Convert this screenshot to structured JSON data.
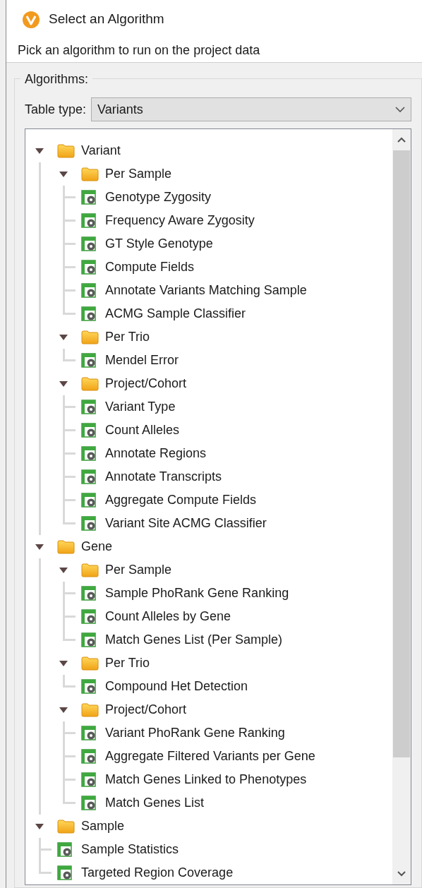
{
  "window": {
    "title": "Select an Algorithm"
  },
  "description": "Pick an algorithm to run on the project data",
  "group": {
    "label": "Algorithms:"
  },
  "table_type": {
    "label": "Table type:",
    "value": "Variants"
  },
  "tree": [
    {
      "kind": "folder",
      "label": "Variant",
      "expanded": true,
      "children": [
        {
          "kind": "folder",
          "label": "Per Sample",
          "expanded": true,
          "children": [
            {
              "kind": "algorithm",
              "label": "Genotype Zygosity"
            },
            {
              "kind": "algorithm",
              "label": "Frequency Aware Zygosity"
            },
            {
              "kind": "algorithm",
              "label": "GT Style Genotype"
            },
            {
              "kind": "algorithm",
              "label": "Compute Fields"
            },
            {
              "kind": "algorithm",
              "label": "Annotate Variants Matching Sample"
            },
            {
              "kind": "algorithm",
              "label": "ACMG Sample Classifier"
            }
          ]
        },
        {
          "kind": "folder",
          "label": "Per Trio",
          "expanded": true,
          "children": [
            {
              "kind": "algorithm",
              "label": "Mendel Error"
            }
          ]
        },
        {
          "kind": "folder",
          "label": "Project/Cohort",
          "expanded": true,
          "children": [
            {
              "kind": "algorithm",
              "label": "Variant Type"
            },
            {
              "kind": "algorithm",
              "label": "Count Alleles"
            },
            {
              "kind": "algorithm",
              "label": "Annotate Regions"
            },
            {
              "kind": "algorithm",
              "label": "Annotate Transcripts"
            },
            {
              "kind": "algorithm",
              "label": "Aggregate Compute Fields"
            },
            {
              "kind": "algorithm",
              "label": "Variant Site ACMG Classifier"
            }
          ]
        }
      ]
    },
    {
      "kind": "folder",
      "label": "Gene",
      "expanded": true,
      "children": [
        {
          "kind": "folder",
          "label": "Per Sample",
          "expanded": true,
          "children": [
            {
              "kind": "algorithm",
              "label": "Sample PhoRank Gene Ranking"
            },
            {
              "kind": "algorithm",
              "label": "Count Alleles by Gene"
            },
            {
              "kind": "algorithm",
              "label": "Match Genes List (Per Sample)"
            }
          ]
        },
        {
          "kind": "folder",
          "label": "Per Trio",
          "expanded": true,
          "children": [
            {
              "kind": "algorithm",
              "label": "Compound Het Detection"
            }
          ]
        },
        {
          "kind": "folder",
          "label": "Project/Cohort",
          "expanded": true,
          "children": [
            {
              "kind": "algorithm",
              "label": "Variant PhoRank Gene Ranking"
            },
            {
              "kind": "algorithm",
              "label": "Aggregate Filtered Variants per Gene"
            },
            {
              "kind": "algorithm",
              "label": "Match Genes Linked to Phenotypes"
            },
            {
              "kind": "algorithm",
              "label": "Match Genes List"
            }
          ]
        }
      ]
    },
    {
      "kind": "folder",
      "label": "Sample",
      "expanded": true,
      "children": [
        {
          "kind": "algorithm",
          "label": "Sample Statistics"
        },
        {
          "kind": "algorithm",
          "label": "Targeted Region Coverage"
        }
      ]
    }
  ]
}
